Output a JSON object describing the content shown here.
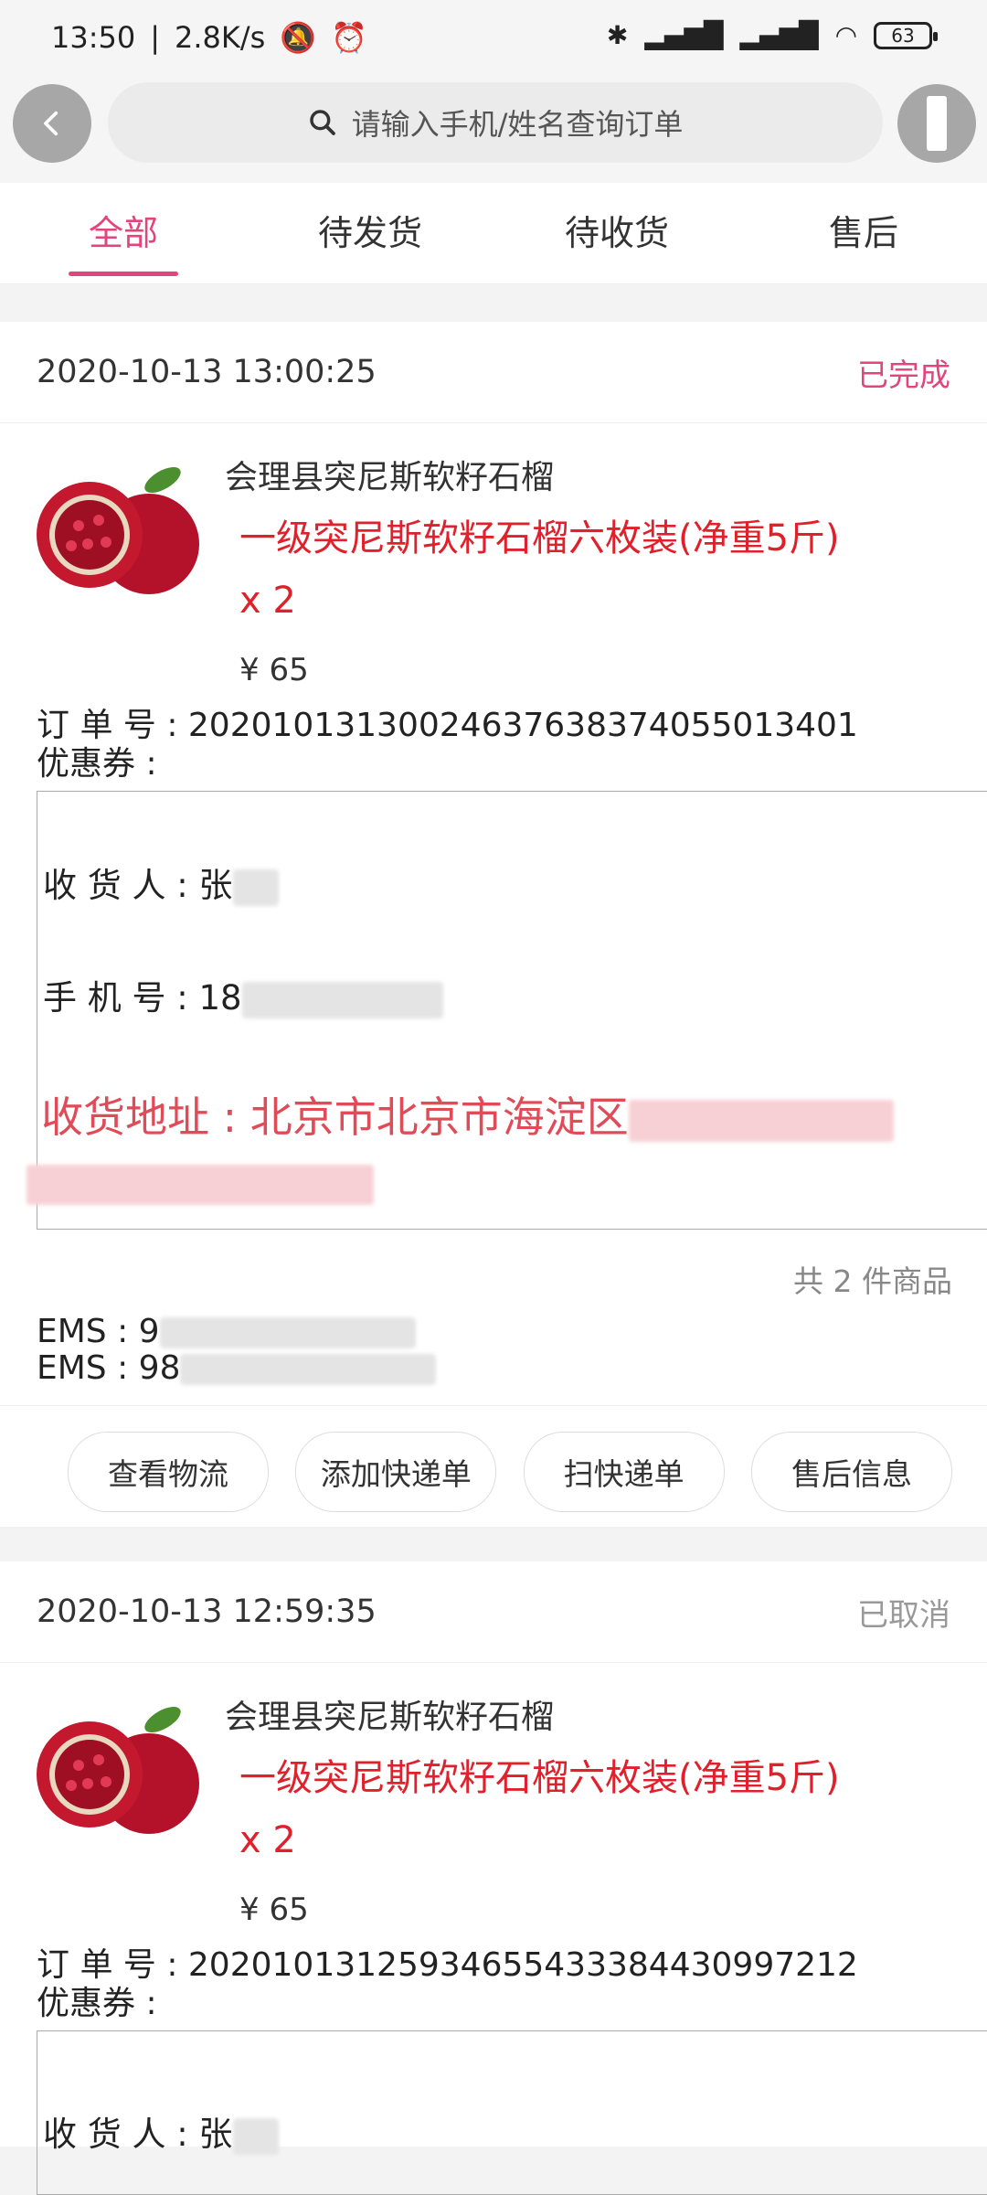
{
  "status_bar": {
    "time": "13:50",
    "speed": "2.8K/s",
    "battery": "63"
  },
  "header": {
    "search_placeholder": "请输入手机/姓名查询订单"
  },
  "tabs": [
    {
      "label": "全部"
    },
    {
      "label": "待发货"
    },
    {
      "label": "待收货"
    },
    {
      "label": "售后"
    }
  ],
  "orders": [
    {
      "datetime": "2020-10-13 13:00:25",
      "status": "已完成",
      "product_name": "会理县突尼斯软籽石榴",
      "spec": "一级突尼斯软籽石榴六枚装(净重5斤)",
      "qty": "x 2",
      "price": "¥ 65",
      "order_no": "订 单 号 : 20201013130024637638374055013401",
      "coupon": "优惠券 :",
      "receiver_label": "收 货 人 : 张",
      "phone_label": "手 机 号 : 18",
      "address": "收货地址 : 北京市北京市海淀区",
      "total": "共 2 件商品",
      "ems1": "EMS : 9",
      "ems2": "EMS : 98",
      "actions": [
        "查看物流",
        "添加快递单",
        "扫快递单",
        "售后信息"
      ]
    },
    {
      "datetime": "2020-10-13 12:59:35",
      "status": "已取消",
      "product_name": "会理县突尼斯软籽石榴",
      "spec": "一级突尼斯软籽石榴六枚装(净重5斤)",
      "qty": "x 2",
      "price": "¥ 65",
      "order_no": "订 单 号 : 20201013125934655433384430997212",
      "coupon": "优惠券 :",
      "receiver_label": "收 货 人 : 张"
    }
  ]
}
